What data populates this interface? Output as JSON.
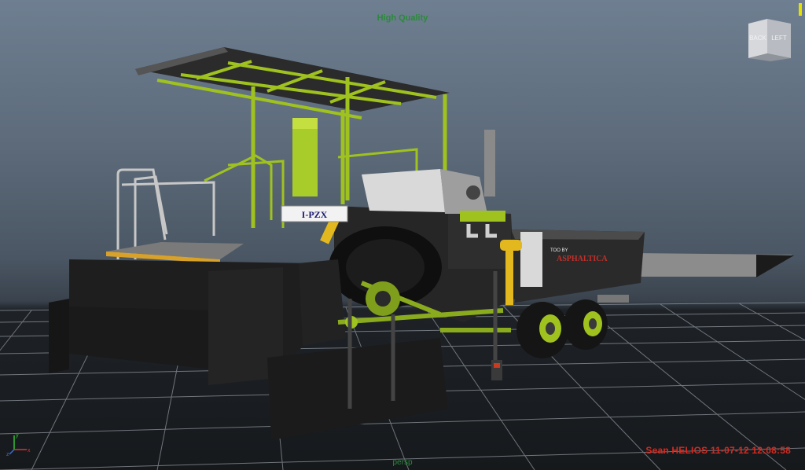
{
  "viewport": {
    "quality_label": "High Quality",
    "camera_label": "persp",
    "stamp": "Sean HELIOS 11-07-12 12:08:58"
  },
  "viewcube": {
    "back_label": "BACK",
    "left_label": "LEFT"
  },
  "model": {
    "decals": {
      "cab_side": "I-PZX",
      "hopper_top": "TOO BY",
      "hopper_main": "ASPHALTICA"
    }
  },
  "colors": {
    "grid_line": "#8e949c",
    "hud_text": "#2a8a3a",
    "stamp_text": "#d52a20",
    "paver_green": "#9fc21f",
    "paver_dark": "#1f1f1f"
  }
}
